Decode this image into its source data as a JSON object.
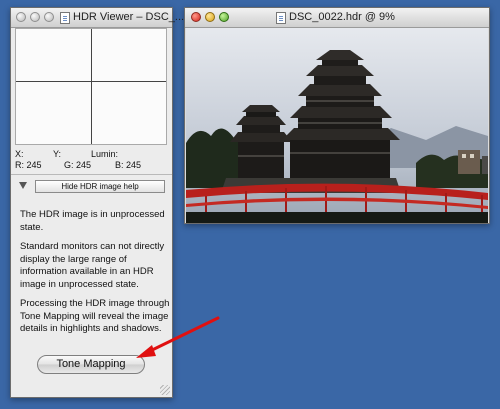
{
  "viewer": {
    "title": "HDR Viewer – DSC_...",
    "readout": {
      "x_label": "X:",
      "y_label": "Y:",
      "lumin_label": "Lumin:",
      "r": "R: 245",
      "g": "G: 245",
      "b": "B: 245"
    },
    "hide_help_label": "Hide HDR image help",
    "help_paragraphs": [
      "The HDR image is in unprocessed state.",
      "Standard monitors can not directly display the large range of information available in an HDR image in unprocessed state.",
      "Processing the HDR image through Tone Mapping will reveal the image details in highlights and shadows."
    ],
    "tone_mapping_label": "Tone Mapping"
  },
  "image_window": {
    "title": "DSC_0022.hdr @  9%"
  },
  "colors": {
    "desktop": "#3a67a6",
    "bridge_red": "#b8201c",
    "annotation_arrow": "#e01010"
  },
  "icons": {
    "document": "document-icon",
    "disclosure": "disclosure-triangle-icon",
    "annotation": "red-arrow-icon"
  }
}
